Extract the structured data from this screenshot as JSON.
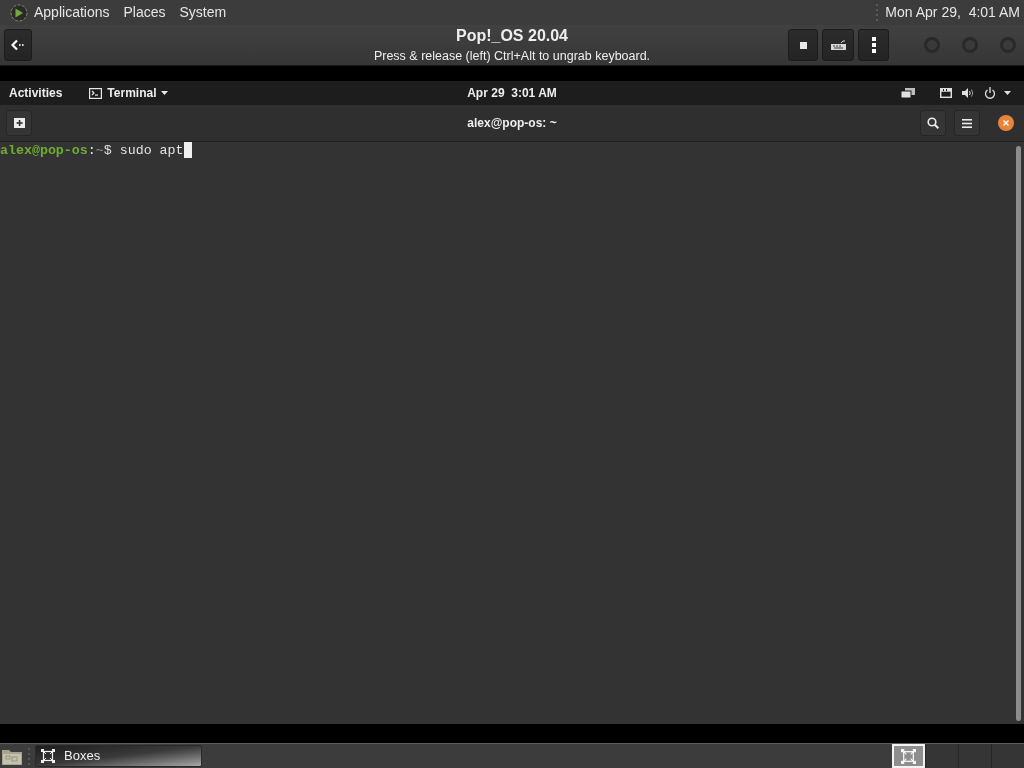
{
  "top_panel": {
    "menus": [
      "Applications",
      "Places",
      "System"
    ],
    "clock": "Mon Apr 29,  4:01 AM"
  },
  "boxes_header": {
    "title": "Pop!_OS 20.04",
    "subtitle": "Press & release (left) Ctrl+Alt to ungrab keyboard."
  },
  "guest_top_bar": {
    "activities": "Activities",
    "app_menu": "Terminal",
    "clock": "Apr 29  3:01 AM"
  },
  "terminal": {
    "title": "alex@pop-os: ~",
    "prompt": {
      "user_host": "alex@pop-os",
      "separator": ":",
      "path": "~",
      "symbol": "$"
    },
    "command": "sudo apt"
  },
  "bottom_panel": {
    "windows": [
      {
        "label": "Boxes"
      }
    ],
    "workspaces": [
      {
        "selected": true
      },
      {
        "selected": false
      },
      {
        "selected": false
      },
      {
        "selected": false
      }
    ]
  }
}
